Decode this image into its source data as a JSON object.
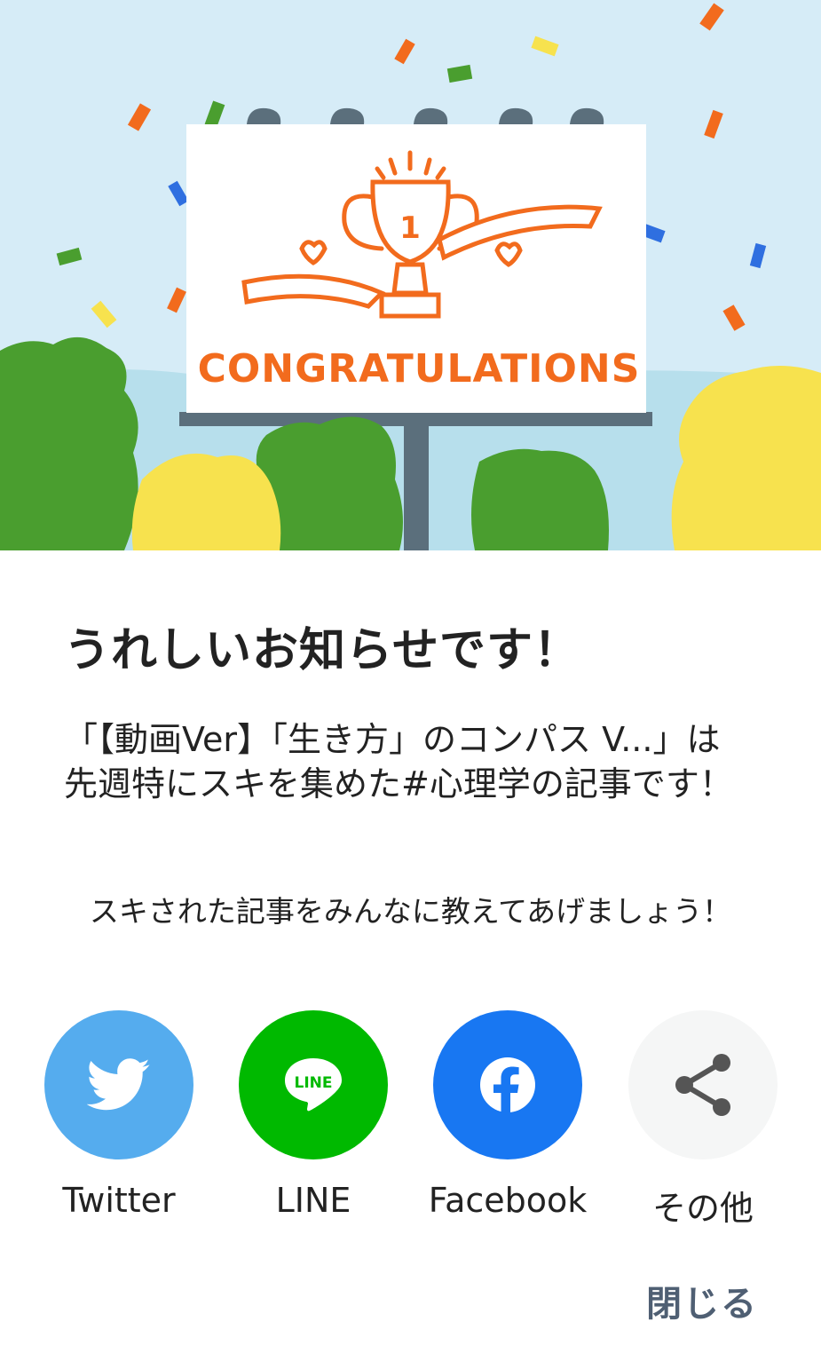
{
  "hero": {
    "banner_text": "CONGRATULATIONS",
    "trophy_number": "1"
  },
  "dialog": {
    "title": "うれしいお知らせです！",
    "description": "「【動画Ver】「生き方」のコンパス V...」は先週特にスキを集めた#心理学の記事です！",
    "prompt": "スキされた記事をみんなに教えてあげましょう！",
    "close_label": "閉じる"
  },
  "share": {
    "items": [
      {
        "label": "Twitter",
        "icon": "twitter-bird-icon",
        "color": "#55acee"
      },
      {
        "label": "LINE",
        "icon": "line-icon",
        "color": "#00b900",
        "icon_text": "LINE"
      },
      {
        "label": "Facebook",
        "icon": "facebook-icon",
        "color": "#1877f2"
      },
      {
        "label": "その他",
        "icon": "share-icon",
        "color": "#f5f6f6"
      }
    ]
  },
  "colors": {
    "accent_orange": "#f26b1d",
    "sky": "#d6ecf7",
    "tree_green": "#4a9e2f",
    "tree_yellow": "#f7e24e",
    "close_text": "#4f5f73"
  }
}
